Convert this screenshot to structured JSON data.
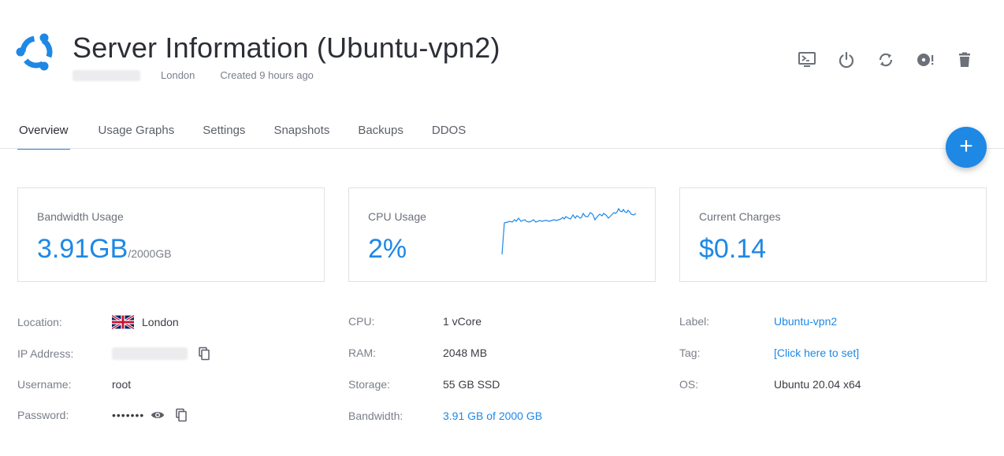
{
  "header": {
    "title": "Server Information (Ubuntu-vpn2)",
    "location": "London",
    "created": "Created 9 hours ago",
    "logo_icon": "ubuntu-logo-icon"
  },
  "actions": [
    {
      "name": "console-icon",
      "title": "Console"
    },
    {
      "name": "power-icon",
      "title": "Power"
    },
    {
      "name": "restart-icon",
      "title": "Restart"
    },
    {
      "name": "iso-icon",
      "title": "ISO"
    },
    {
      "name": "trash-icon",
      "title": "Delete"
    }
  ],
  "tabs": [
    {
      "label": "Overview",
      "active": true
    },
    {
      "label": "Usage Graphs"
    },
    {
      "label": "Settings"
    },
    {
      "label": "Snapshots"
    },
    {
      "label": "Backups"
    },
    {
      "label": "DDOS"
    }
  ],
  "fab": {
    "label": "+"
  },
  "cards": {
    "bandwidth": {
      "label": "Bandwidth Usage",
      "value": "3.91GB",
      "unit": "/2000GB"
    },
    "cpu": {
      "label": "CPU Usage",
      "value": "2%"
    },
    "charges": {
      "label": "Current Charges",
      "value": "$0.14"
    }
  },
  "details": {
    "location": {
      "label": "Location:",
      "value": "London"
    },
    "ip": {
      "label": "IP Address:"
    },
    "username": {
      "label": "Username:",
      "value": "root"
    },
    "password": {
      "label": "Password:",
      "value": "•••••••"
    },
    "cpu": {
      "label": "CPU:",
      "value": "1 vCore"
    },
    "ram": {
      "label": "RAM:",
      "value": "2048 MB"
    },
    "storage": {
      "label": "Storage:",
      "value": "55 GB SSD"
    },
    "bandwidth": {
      "label": "Bandwidth:",
      "value": "3.91 GB of 2000 GB"
    },
    "server_label": {
      "label": "Label:",
      "value": "Ubuntu-vpn2"
    },
    "tag": {
      "label": "Tag:",
      "value": "[Click here to set]"
    },
    "os": {
      "label": "OS:",
      "value": "Ubuntu 20.04 x64"
    }
  },
  "colors": {
    "accent": "#1e88e5",
    "text": "#3a3d44",
    "muted": "#7a7f89"
  }
}
